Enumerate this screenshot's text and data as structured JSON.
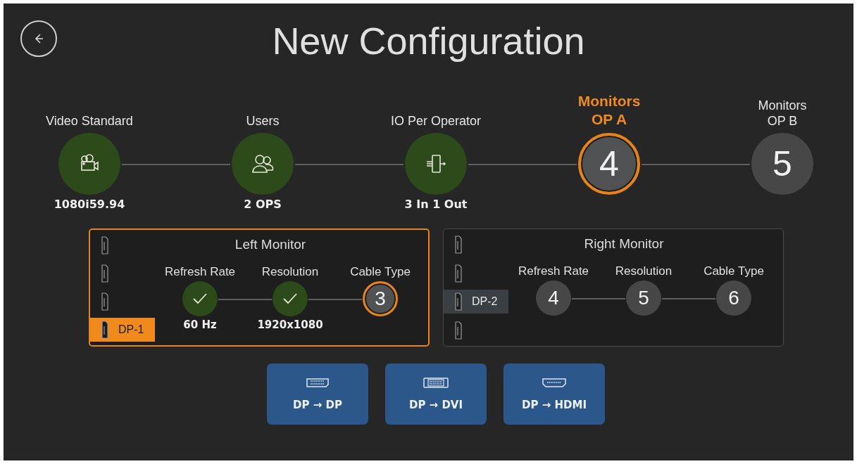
{
  "title": "New Configuration",
  "steps": [
    {
      "label": "Video Standard",
      "completed": true,
      "selected": false,
      "value": "1080i59.94"
    },
    {
      "label": "Users",
      "completed": true,
      "selected": false,
      "value": "2 OPS"
    },
    {
      "label": "IO Per Operator",
      "completed": true,
      "selected": false,
      "value": "3 In 1 Out"
    },
    {
      "label": "Monitors OP A",
      "completed": false,
      "selected": true,
      "number": "4"
    },
    {
      "label": "Monitors OP B",
      "completed": false,
      "selected": false,
      "number": "5"
    }
  ],
  "monitors": [
    {
      "title": "Left Monitor",
      "selected": true,
      "ports": [
        {
          "selected": false
        },
        {
          "selected": false
        },
        {
          "selected": false
        },
        {
          "selected": true,
          "label": "DP-1"
        }
      ],
      "settings": [
        {
          "label": "Refresh Rate",
          "completed": true,
          "selected": false,
          "value": "60 Hz"
        },
        {
          "label": "Resolution",
          "completed": true,
          "selected": false,
          "value": "1920x1080"
        },
        {
          "label": "Cable Type",
          "completed": false,
          "selected": true,
          "number": "3"
        }
      ]
    },
    {
      "title": "Right Monitor",
      "selected": false,
      "ports": [
        {
          "selected": false
        },
        {
          "selected": false
        },
        {
          "selected": true,
          "label": "DP-2"
        },
        {
          "selected": false
        }
      ],
      "settings": [
        {
          "label": "Refresh Rate",
          "completed": false,
          "selected": false,
          "number": "4"
        },
        {
          "label": "Resolution",
          "completed": false,
          "selected": false,
          "number": "5"
        },
        {
          "label": "Cable Type",
          "completed": false,
          "selected": false,
          "number": "6"
        }
      ]
    }
  ],
  "cable_options": [
    {
      "label": "DP → DP"
    },
    {
      "label": "DP → DVI"
    },
    {
      "label": "DP → HDMI"
    }
  ]
}
